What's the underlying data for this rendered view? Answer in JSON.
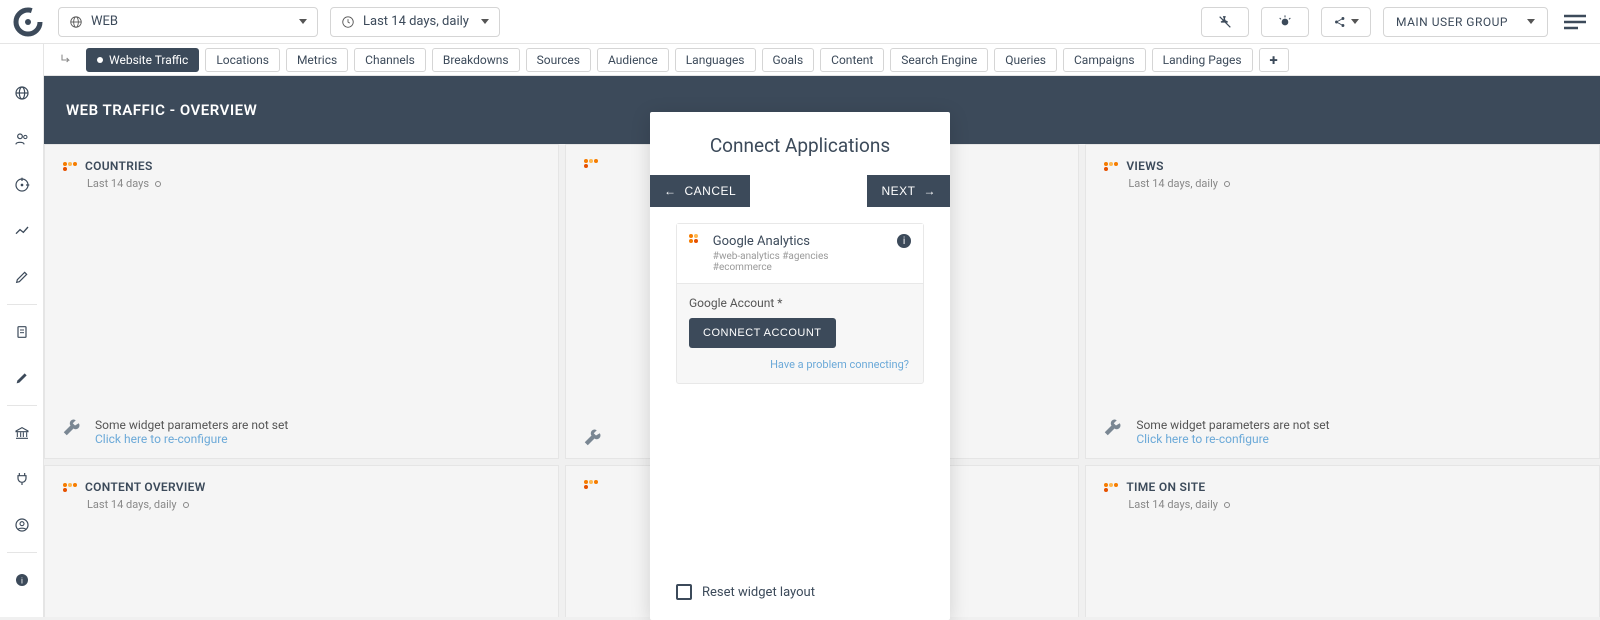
{
  "topbar": {
    "scope_label": "WEB",
    "date_label": "Last 14 days, daily",
    "usergroup": "MAIN USER GROUP"
  },
  "tabs": [
    {
      "label": "Website Traffic",
      "active": true
    },
    {
      "label": "Locations"
    },
    {
      "label": "Metrics"
    },
    {
      "label": "Channels"
    },
    {
      "label": "Breakdowns"
    },
    {
      "label": "Sources"
    },
    {
      "label": "Audience"
    },
    {
      "label": "Languages"
    },
    {
      "label": "Goals"
    },
    {
      "label": "Content"
    },
    {
      "label": "Search Engine"
    },
    {
      "label": "Queries"
    },
    {
      "label": "Campaigns"
    },
    {
      "label": "Landing Pages"
    }
  ],
  "page_title": "WEB TRAFFIC - OVERVIEW",
  "widgets": {
    "row1": [
      {
        "title": "COUNTRIES",
        "sub": "Last 14 days",
        "warn": "Some widget parameters are not set",
        "link": "Click here to re-configure"
      },
      {
        "title": "",
        "sub": "",
        "warn": "",
        "link": ""
      },
      {
        "title": "VIEWS",
        "sub": "Last 14 days, daily",
        "warn": "Some widget parameters are not set",
        "link": "Click here to re-configure"
      }
    ],
    "row2": [
      {
        "title": "CONTENT OVERVIEW",
        "sub": "Last 14 days, daily"
      },
      {
        "title": "",
        "sub": ""
      },
      {
        "title": "TIME ON SITE",
        "sub": "Last 14 days, daily"
      }
    ]
  },
  "modal": {
    "title": "Connect Applications",
    "cancel": "CANCEL",
    "next": "NEXT",
    "app_name": "Google Analytics",
    "app_tags": "#web-analytics #agencies #ecommerce",
    "field_label": "Google Account *",
    "connect_btn": "CONNECT ACCOUNT",
    "help_link": "Have a problem connecting?",
    "reset_label": "Reset widget layout"
  }
}
